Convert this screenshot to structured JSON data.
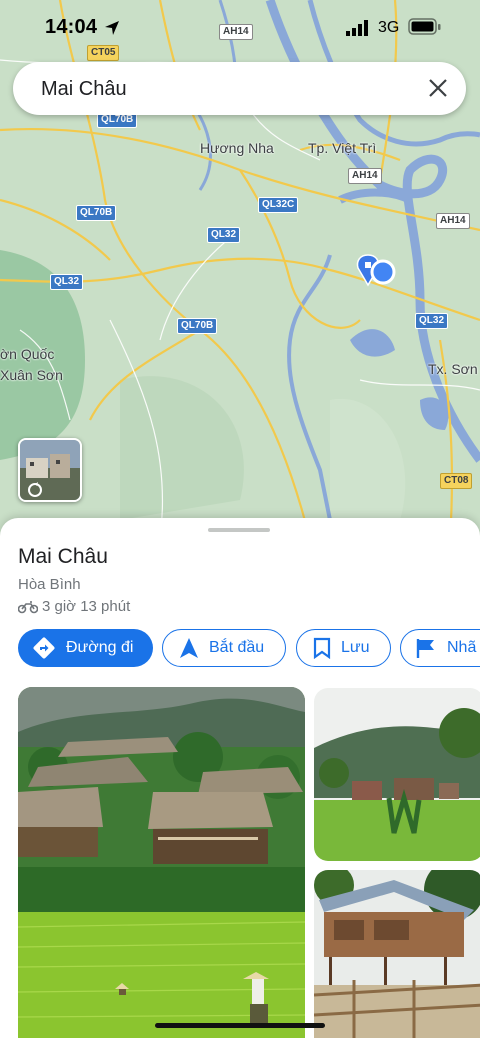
{
  "status_bar": {
    "time": "14:04",
    "network": "3G"
  },
  "search": {
    "query": "Mai Châu"
  },
  "map": {
    "places": [
      "Hương Nha",
      "Tp. Việt Trì",
      "ờn Quốc",
      "Xuân Sơn",
      "Tx. Sơn Tây"
    ],
    "roads": [
      "CT05",
      "QL70B",
      "AH14",
      "QL32C",
      "QL70B",
      "QL32",
      "QL32",
      "QL70B",
      "AH14",
      "QL32",
      "CT08"
    ]
  },
  "place": {
    "name": "Mai Châu",
    "region": "Hòa Bình",
    "drive_time": "3 giờ 13 phút"
  },
  "actions": [
    {
      "label": "Đường đi",
      "icon": "directions-icon"
    },
    {
      "label": "Bắt đầu",
      "icon": "navigation-arrow-icon"
    },
    {
      "label": "Lưu",
      "icon": "bookmark-icon"
    },
    {
      "label": "Nhã",
      "icon": "flag-icon"
    }
  ],
  "colors": {
    "accent": "#1a73e8",
    "map_land": "#c7dfc6",
    "river": "#8aa8d8"
  }
}
